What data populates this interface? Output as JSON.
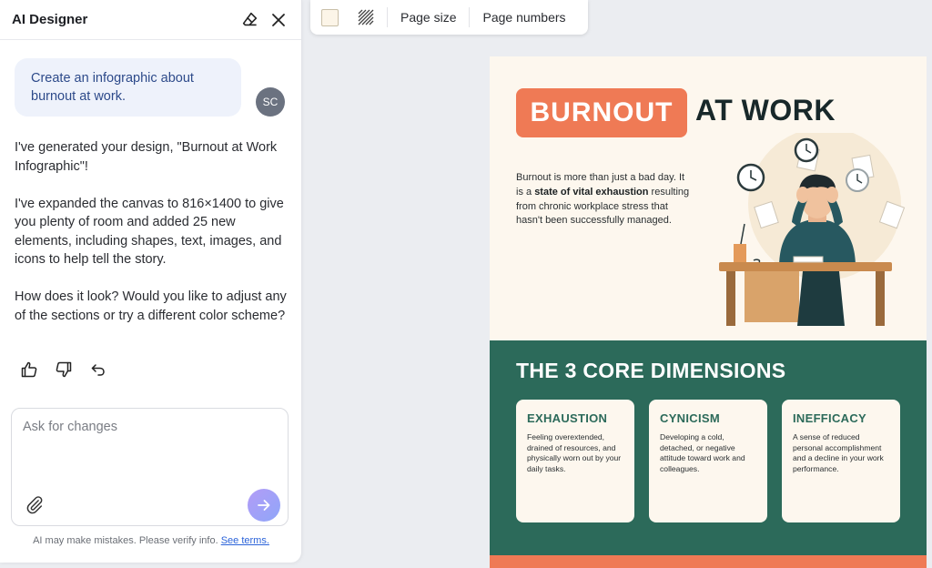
{
  "sidebar": {
    "title": "AI Designer",
    "user_message": "Create an infographic about burnout at work.",
    "avatar_initials": "SC",
    "ai_response": [
      "I've generated your design, \"Burnout at Work Infographic\"!",
      "I've expanded the canvas to 816×1400 to give you plenty of room and added 25 new elements, including shapes, text, images, and icons to help tell the story.",
      "How does it look? Would you like to adjust any of the sections or try a different color scheme?"
    ],
    "input_placeholder": "Ask for changes",
    "disclaimer": "AI may make mistakes. Please verify info.",
    "terms_link": "See terms."
  },
  "toolbar": {
    "page_size": "Page size",
    "page_numbers": "Page numbers",
    "background_color": "#fcf5e8"
  },
  "infographic": {
    "title_highlight": "BURNOUT",
    "title_rest": "AT WORK",
    "intro": {
      "part1": "Burnout is more than just a bad day. It is a ",
      "bold": "state of vital exhaustion",
      "part2": " resulting from chronic workplace stress that hasn't been successfully managed."
    },
    "dimensions_title": "THE 3 CORE DIMENSIONS",
    "cards": [
      {
        "title": "EXHAUSTION",
        "text": "Feeling overextended, drained of resources, and physically worn out by your daily tasks."
      },
      {
        "title": "CYNICISM",
        "text": "Developing a cold, detached, or negative attitude toward work and colleagues."
      },
      {
        "title": "INEFFICACY",
        "text": "A sense of reduced personal accomplishment and a decline in your work performance."
      }
    ],
    "colors": {
      "accent": "#ef7a55",
      "green": "#2c6a5a",
      "cream": "#fdf7ee"
    }
  }
}
